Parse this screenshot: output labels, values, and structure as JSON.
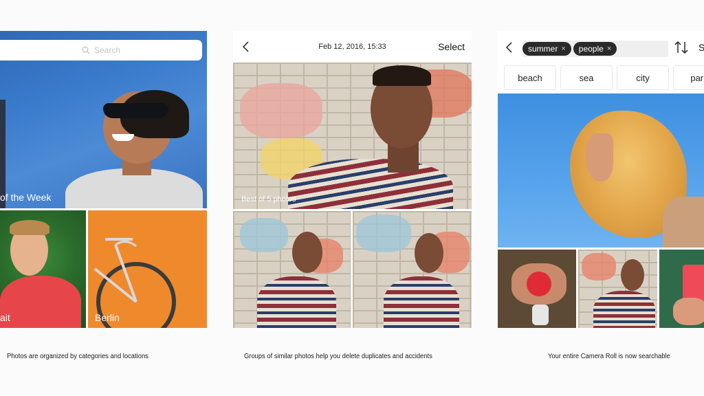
{
  "panel1": {
    "search_placeholder": "Search",
    "hero_label": "of the Week",
    "cell_left_label": "ait",
    "cell_right_label": "Berlin"
  },
  "panel2": {
    "date": "Feb 12, 2016, 15:33",
    "select_label": "Select",
    "main_label": "Best of 5 photos"
  },
  "panel3": {
    "tokens": [
      {
        "label": "summer",
        "remove": "×"
      },
      {
        "label": "people",
        "remove": "×"
      }
    ],
    "overflow_label": "S",
    "chips": [
      "beach",
      "sea",
      "city",
      "park"
    ]
  },
  "captions": {
    "c1": "Photos are organized by categories and locations",
    "c2": "Groups of similar photos help you delete duplicates and accidents",
    "c3": "Your entire Camera Roll is now searchable"
  },
  "icons": {
    "search": "magnifier-icon",
    "back": "chevron-left-icon",
    "sort": "sort-arrows-icon"
  },
  "colors": {
    "token_bg": "#2a2a2a",
    "accent_orange": "#ef8a2c",
    "sky_blue": "#3e8fe0"
  }
}
